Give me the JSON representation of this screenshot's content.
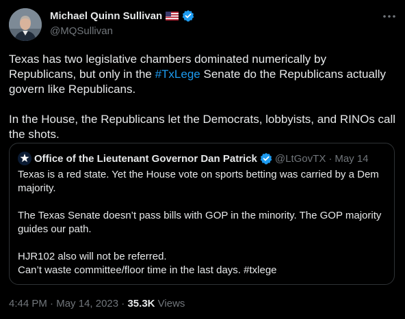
{
  "author": {
    "display_name": "Michael Quinn Sullivan",
    "handle": "@MQSullivan",
    "flag_icon": "us-flag-icon",
    "verified_icon": "verified-badge-icon"
  },
  "tweet": {
    "p1_before": "Texas has two legislative chambers dominated numerically by Republicans, but only in the ",
    "hashtag": "#TxLege",
    "p1_after": " Senate do the Republicans actually govern like Republicans.",
    "p2": "In the House, the Republicans let the Democrats, lobbyists, and RINOs call the shots."
  },
  "quoted": {
    "display_name": "Office of the Lieutenant Governor Dan Patrick",
    "handle": "@LtGovTX",
    "separator": "·",
    "date": "May 14",
    "p1": "Texas is a red state. Yet the House vote on sports betting was carried by a Dem majority.",
    "p2": "The Texas Senate doesn’t pass bills with GOP in the minority. The GOP majority guides our path.",
    "p3_line1": "HJR102 also will not be referred.",
    "p3_line2": "Can’t waste committee/floor time in the last days. #txlege"
  },
  "meta": {
    "time": "4:44 PM",
    "separator": "·",
    "date": "May 14, 2023",
    "views_count": "35.3K",
    "views_label": "Views"
  },
  "colors": {
    "background": "#000000",
    "text": "#e7e9ea",
    "secondary": "#71767b",
    "link": "#1d9bf0",
    "verified_blue": "#1d9bf0",
    "border": "#2f3336"
  }
}
